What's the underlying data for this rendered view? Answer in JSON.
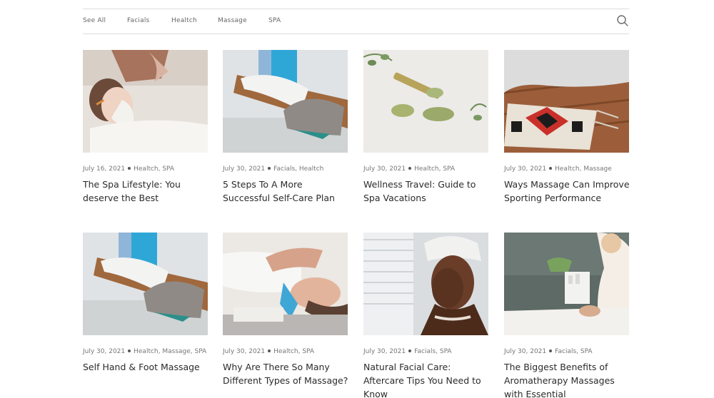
{
  "filters": [
    {
      "label": "See All"
    },
    {
      "label": "Facials"
    },
    {
      "label": "Healtch"
    },
    {
      "label": "Massage"
    },
    {
      "label": "SPA"
    }
  ],
  "search": {
    "icon": "search-icon"
  },
  "posts": [
    {
      "date": "July 16, 2021",
      "tags": "Healtch, SPA",
      "title": "The Spa Lifestyle: You deserve the Best"
    },
    {
      "date": "July 30, 2021",
      "tags": "Facials, Healtch",
      "title": "5 Steps To A More Successful Self-Care Plan"
    },
    {
      "date": "July 30, 2021",
      "tags": "Healtch, SPA",
      "title": "Wellness Travel: Guide to Spa Vacations"
    },
    {
      "date": "July 30, 2021",
      "tags": "Healtch, Massage",
      "title": "Ways Massage Can Improve Sporting Performance"
    },
    {
      "date": "July 30, 2021",
      "tags": "Healtch, Massage, SPA",
      "title": "Self Hand & Foot Massage"
    },
    {
      "date": "July 30, 2021",
      "tags": "Healtch, SPA",
      "title": "Why Are There So Many Different Types of Massage?"
    },
    {
      "date": "July 30, 2021",
      "tags": "Facials, SPA",
      "title": "Natural Facial Care: Aftercare Tips You Need to Know"
    },
    {
      "date": "July 30, 2021",
      "tags": "Facials, SPA",
      "title": "The Biggest Benefits of Aromatherapy Massages with Essential"
    }
  ]
}
